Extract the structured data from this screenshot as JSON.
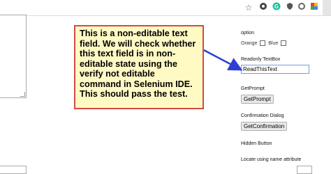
{
  "toolbar": {
    "icons": [
      "star-icon",
      "extension-dark-icon",
      "grammar-c-icon",
      "extension-shield-icon",
      "extension-ring-icon",
      "extension-colored-icon"
    ]
  },
  "right_panel": {
    "option_label": "option",
    "orange_label": "Orange",
    "blue_label": "Blue",
    "readonly_label": "Readonly TextBox",
    "readonly_value": "ReadThisText",
    "getprompt_label": "GetPrompt",
    "getprompt_button": "GetPrompt",
    "confirmation_label": "Confirmation Dialog",
    "confirmation_button": "GetConfirmation",
    "hidden_label": "Hidden Button",
    "locate_label": "Locate using name attribute"
  },
  "callout": {
    "text": "This is a non-editable text field. We will check whether this text field is in non-editable state using the verify not editable command in Selenium IDE. This should pass the test."
  },
  "colors": {
    "callout_bg": "#fff9c4",
    "callout_border": "#d24a43",
    "arrow": "#2b3fd6"
  }
}
